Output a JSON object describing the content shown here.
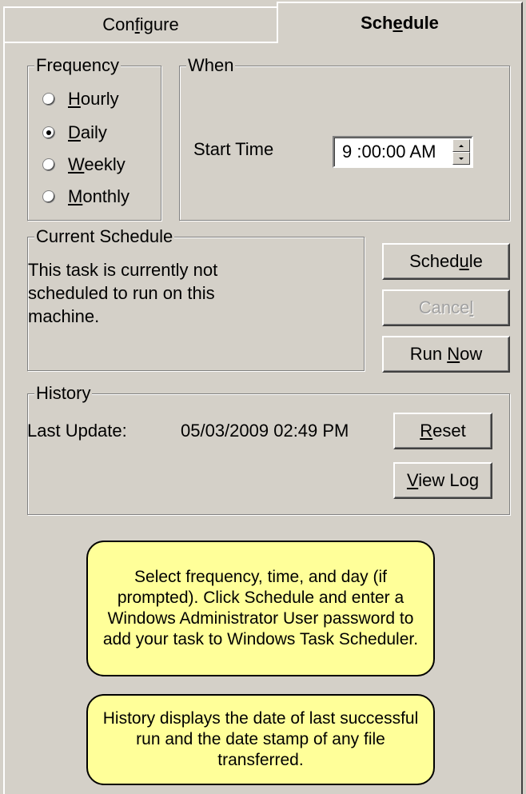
{
  "tabs": {
    "configure": {
      "pre": "Con",
      "u": "f",
      "post": "igure"
    },
    "schedule": {
      "pre": "Sch",
      "u": "e",
      "post": "dule"
    }
  },
  "frequency": {
    "legend": "Frequency",
    "options": [
      {
        "u": "H",
        "rest": "ourly",
        "checked": false
      },
      {
        "u": "D",
        "rest": "aily",
        "checked": true
      },
      {
        "u": "W",
        "rest": "eekly",
        "checked": false
      },
      {
        "u": "M",
        "rest": "onthly",
        "checked": false
      }
    ]
  },
  "when": {
    "legend": "When",
    "start_time_label": "Start Time",
    "start_time_value": "9 :00:00 AM"
  },
  "current_schedule": {
    "legend": "Current Schedule",
    "text": "This task is currently not scheduled to run on this machine."
  },
  "buttons": {
    "schedule": {
      "pre": "Sched",
      "u": "u",
      "post": "le"
    },
    "cancel": {
      "pre": "Cance",
      "u": "l",
      "post": ""
    },
    "run_now": {
      "pre": "Run ",
      "u": "N",
      "post": "ow"
    },
    "reset": {
      "pre": "",
      "u": "R",
      "post": "eset"
    },
    "view_log": {
      "pre": "",
      "u": "V",
      "post": "iew Log"
    }
  },
  "history": {
    "legend": "History",
    "last_update_label": "Last Update:",
    "last_update_value": "05/03/2009 02:49 PM"
  },
  "notes": {
    "schedule_help": "Select frequency, time, and day (if prompted). Click Schedule and enter a Windows Administrator User password to add your task to Windows Task Scheduler.",
    "history_help": "History displays the date of last successful run and the date stamp of any file transferred."
  },
  "colors": {
    "background": "#d4d0c8",
    "note_background": "#ffff99",
    "disabled_text": "#a0a0a0"
  }
}
